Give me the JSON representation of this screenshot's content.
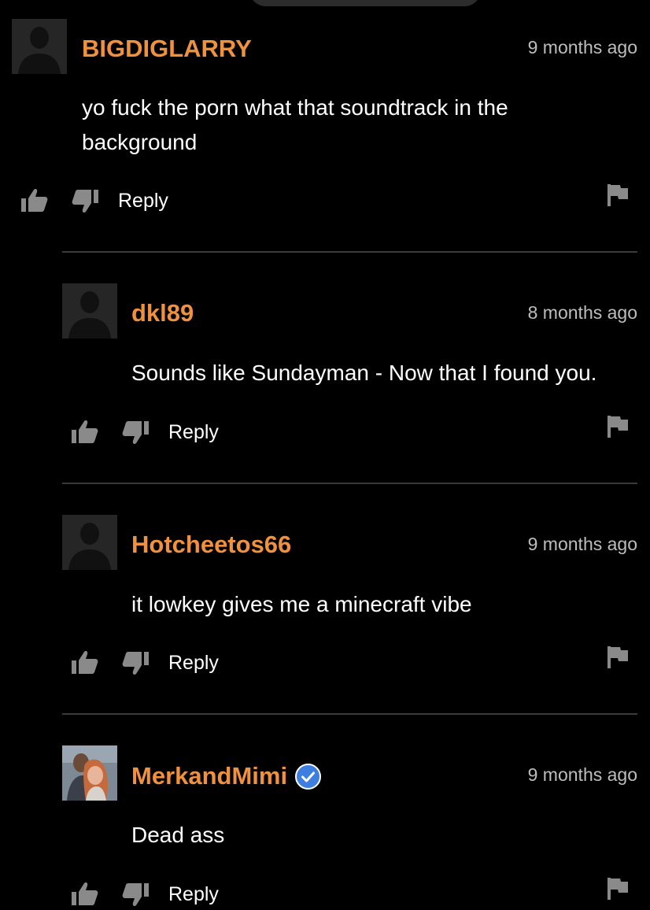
{
  "comments": [
    {
      "username": "BIGDIGLARRY",
      "time": "9 months ago",
      "text": "yo fuck the porn what that soundtrack in the background",
      "reply_label": "Reply",
      "verified": false
    },
    {
      "username": "dkl89",
      "time": "8 months ago",
      "text": "Sounds like Sundayman - Now that I found you.",
      "reply_label": "Reply",
      "verified": false
    },
    {
      "username": "Hotcheetos66",
      "time": "9 months ago",
      "text": "it lowkey gives me a minecraft vibe",
      "reply_label": "Reply",
      "verified": false
    },
    {
      "username": "MerkandMimi",
      "time": "9 months ago",
      "text": "Dead ass",
      "reply_label": "Reply",
      "verified": true
    }
  ],
  "icons": {
    "thumbs_up": "thumbs-up-icon",
    "thumbs_down": "thumbs-down-icon",
    "flag": "flag-icon",
    "verified": "verified-badge-icon",
    "avatar_placeholder": "default-avatar-icon"
  },
  "colors": {
    "background": "#000000",
    "username": "#f0913e",
    "timestamp": "#bdbdbd",
    "icon": "#8a8a8a",
    "verified": "#3d7fe0"
  }
}
